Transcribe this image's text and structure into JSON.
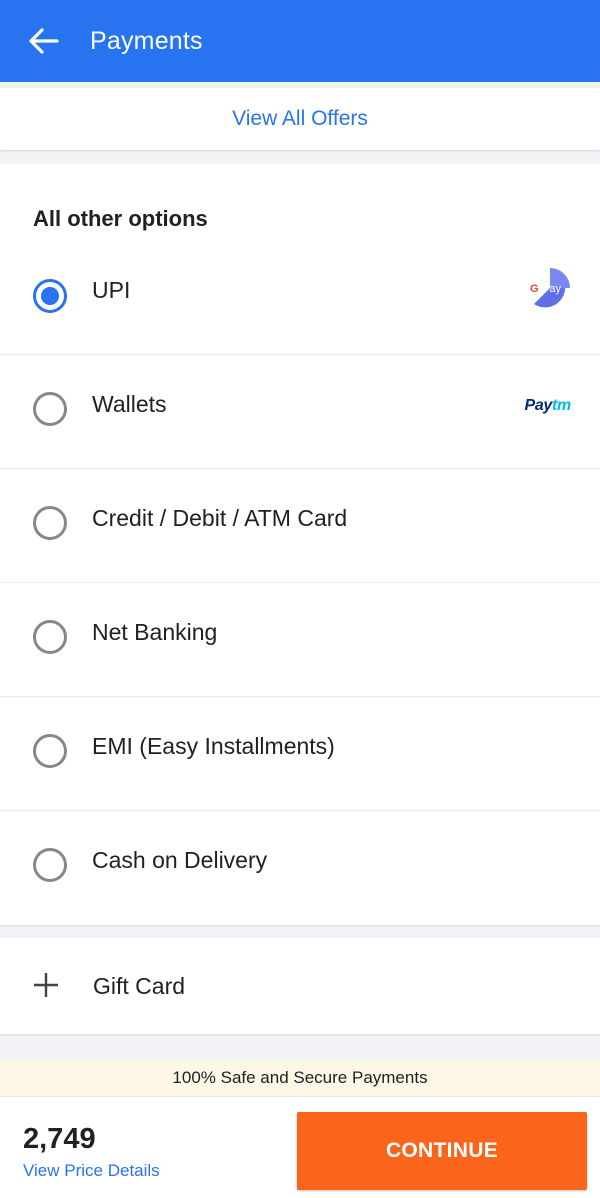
{
  "header": {
    "title": "Payments",
    "background": "#2874f0"
  },
  "offers": {
    "link_label": "View All Offers"
  },
  "options": {
    "title": "All other options",
    "items": [
      {
        "label": "UPI",
        "selected": true,
        "logo": "gpay-icon"
      },
      {
        "label": "Wallets",
        "selected": false,
        "logo": "paytm-logo"
      },
      {
        "label": "Credit / Debit / ATM Card",
        "selected": false
      },
      {
        "label": "Net Banking",
        "selected": false
      },
      {
        "label": "EMI (Easy Installments)",
        "selected": false
      },
      {
        "label": "Cash on Delivery",
        "selected": false
      }
    ]
  },
  "gift_card": {
    "icon": "plus-icon",
    "label": "Gift Card"
  },
  "secure_banner": {
    "text": "100% Safe and Secure Payments"
  },
  "footer": {
    "price": "2,749",
    "price_details_link": "View Price Details",
    "continue_label": "CONTINUE",
    "continue_color": "#fb641b"
  },
  "logos": {
    "gpay_g": "G",
    "gpay_pay": "Pay",
    "paytm_pay": "Pay",
    "paytm_tm": "tm"
  }
}
